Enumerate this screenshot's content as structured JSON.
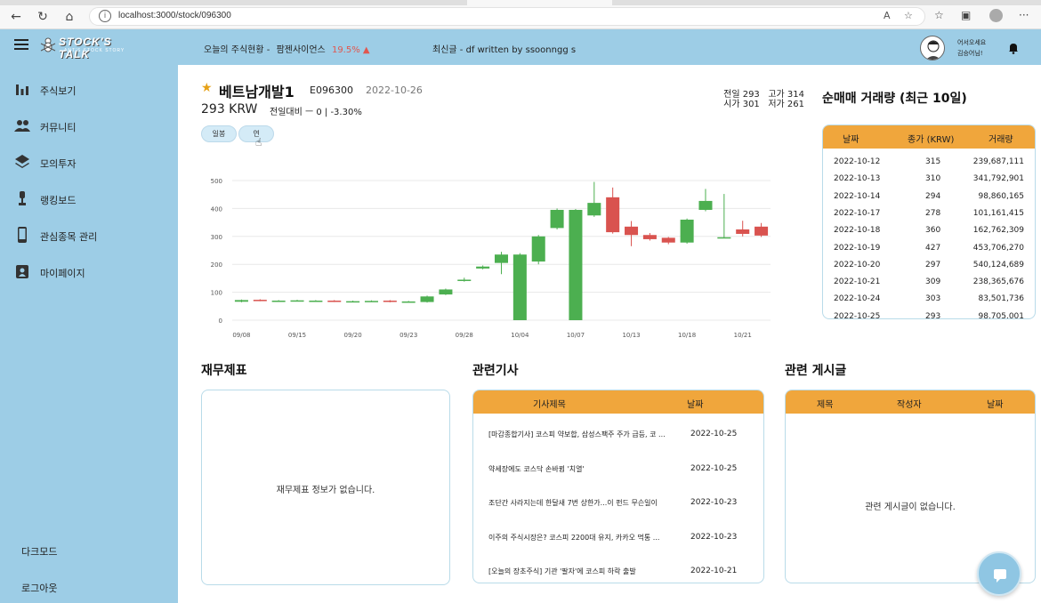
{
  "browser": {
    "url": "localhost:3000/stock/096300",
    "reader_label": "A"
  },
  "brand": {
    "name": "STOCK'S TALK",
    "tagline": "ANT'S STOCK STORY"
  },
  "sidebar": {
    "items": [
      {
        "label": "주식보기",
        "icon": "bar-chart-icon"
      },
      {
        "label": "커뮤니티",
        "icon": "people-icon"
      },
      {
        "label": "모의투자",
        "icon": "layers-icon"
      },
      {
        "label": "랭킹보드",
        "icon": "trophy-icon"
      },
      {
        "label": "관심종목 관리",
        "icon": "phone-icon"
      },
      {
        "label": "마이페이지",
        "icon": "badge-icon"
      }
    ],
    "dark_mode": "다크모드",
    "logout": "로그아웃"
  },
  "topbar": {
    "today_label": "오늘의 주식현황 -",
    "today_stock": "팜젠사이언스",
    "today_pct": "19.5%",
    "latest": "최신글 - df written by ssoonngg s",
    "greeting_line1": "어서오세요",
    "greeting_line2": "김승어님!"
  },
  "stock": {
    "name": "베트남개발1",
    "code": "E096300",
    "date": "2022-10-26",
    "price": "293 KRW",
    "diff": "전일대비 ㅡ 0 | -3.30%",
    "quote_line1": "전일 293   고가 314",
    "quote_line2": "시가 301   저가 261",
    "period_buttons": [
      "일봉",
      "연"
    ]
  },
  "chart_data": {
    "type": "candlestick",
    "ylim": [
      0,
      500
    ],
    "yticks": [
      "0",
      "100",
      "200",
      "300",
      "400",
      "500"
    ],
    "xticks": [
      "09/08",
      "09/15",
      "09/20",
      "09/23",
      "09/28",
      "10/04",
      "10/07",
      "10/13",
      "10/18",
      "10/21"
    ],
    "candles": [
      {
        "o": 66,
        "c": 72,
        "h": 74,
        "l": 64
      },
      {
        "o": 73,
        "c": 70,
        "h": 75,
        "l": 68
      },
      {
        "o": 68,
        "c": 70,
        "h": 72,
        "l": 66
      },
      {
        "o": 69,
        "c": 71,
        "h": 73,
        "l": 67
      },
      {
        "o": 69,
        "c": 70,
        "h": 72,
        "l": 67
      },
      {
        "o": 70,
        "c": 67,
        "h": 72,
        "l": 65
      },
      {
        "o": 67,
        "c": 68,
        "h": 70,
        "l": 65
      },
      {
        "o": 68,
        "c": 69,
        "h": 71,
        "l": 66
      },
      {
        "o": 70,
        "c": 66,
        "h": 72,
        "l": 64
      },
      {
        "o": 66,
        "c": 67,
        "h": 69,
        "l": 64
      },
      {
        "o": 65,
        "c": 85,
        "h": 88,
        "l": 63
      },
      {
        "o": 92,
        "c": 110,
        "h": 113,
        "l": 90
      },
      {
        "o": 142,
        "c": 145,
        "h": 152,
        "l": 138
      },
      {
        "o": 185,
        "c": 192,
        "h": 196,
        "l": 182
      },
      {
        "o": 205,
        "c": 235,
        "h": 245,
        "l": 165
      },
      {
        "o": 0,
        "c": 235,
        "h": 240,
        "l": 0
      },
      {
        "o": 210,
        "c": 300,
        "h": 305,
        "l": 200
      },
      {
        "o": 330,
        "c": 395,
        "h": 400,
        "l": 325
      },
      {
        "o": 0,
        "c": 395,
        "h": 398,
        "l": 0
      },
      {
        "o": 375,
        "c": 420,
        "h": 495,
        "l": 370
      },
      {
        "o": 440,
        "c": 315,
        "h": 475,
        "l": 310
      },
      {
        "o": 335,
        "c": 305,
        "h": 355,
        "l": 265
      },
      {
        "o": 305,
        "c": 290,
        "h": 312,
        "l": 285
      },
      {
        "o": 295,
        "c": 278,
        "h": 298,
        "l": 272
      },
      {
        "o": 278,
        "c": 360,
        "h": 364,
        "l": 274
      },
      {
        "o": 395,
        "c": 427,
        "h": 470,
        "l": 390
      },
      {
        "o": 297,
        "c": 297,
        "h": 452,
        "l": 295
      },
      {
        "o": 325,
        "c": 309,
        "h": 356,
        "l": 300
      },
      {
        "o": 335,
        "c": 303,
        "h": 348,
        "l": 298
      }
    ],
    "up_color": "#4caf50",
    "down_color": "#d9534f"
  },
  "volume": {
    "title": "순매매 거래량 (최근 10일)",
    "headers": [
      "날짜",
      "종가 (KRW)",
      "거래량"
    ],
    "rows": [
      [
        "2022-10-12",
        "315",
        "239,687,111"
      ],
      [
        "2022-10-13",
        "310",
        "341,792,901"
      ],
      [
        "2022-10-14",
        "294",
        "98,860,165"
      ],
      [
        "2022-10-17",
        "278",
        "101,161,415"
      ],
      [
        "2022-10-18",
        "360",
        "162,762,309"
      ],
      [
        "2022-10-19",
        "427",
        "453,706,270"
      ],
      [
        "2022-10-20",
        "297",
        "540,124,689"
      ],
      [
        "2022-10-21",
        "309",
        "238,365,676"
      ],
      [
        "2022-10-24",
        "303",
        "83,501,736"
      ],
      [
        "2022-10-25",
        "293",
        "98,705,001"
      ]
    ]
  },
  "financials": {
    "title": "재무제표",
    "empty": "재무제표 정보가 없습니다."
  },
  "news": {
    "title": "관련기사",
    "headers": [
      "기사제목",
      "날짜"
    ],
    "rows": [
      [
        "[마감종합기사] 코스피 약보합, 삼성스팩주 주가 급등, 코 ...",
        "2022-10-25"
      ],
      [
        "약세장에도 코스닥 손바뀜 '치열'",
        "2022-10-25"
      ],
      [
        "조단간 사라지는데 한달새 7번 상한가...이 펀드 무슨일이",
        "2022-10-23"
      ],
      [
        "이주의 주식시장은? 코스피 2200대 유지, 카카오 먹통 ...",
        "2022-10-23"
      ],
      [
        "[오늘의 장초주식] 기관 '팔자'에 코스피 하락 출발",
        "2022-10-21"
      ]
    ]
  },
  "posts": {
    "title": "관련 게시글",
    "headers": [
      "제목",
      "작성자",
      "날짜"
    ],
    "empty": "관련 게시글이 없습니다."
  },
  "colors": {
    "sidebar_bg": "#9dcde6",
    "table_header": "#f0a63c",
    "accent_star": "#e6a117"
  }
}
